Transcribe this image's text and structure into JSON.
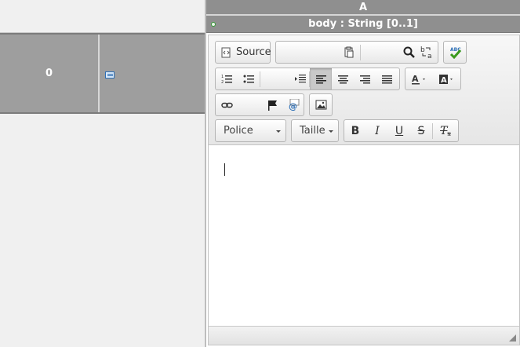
{
  "grid": {
    "row_value": "0"
  },
  "column_header": "A",
  "field_header": "body : String [0..1]",
  "toolbar": {
    "source_label": "Source",
    "font_label": "Police",
    "size_label": "Taille",
    "bold_label": "B",
    "italic_label": "I",
    "underline_label": "U",
    "strike_label": "S",
    "remove_format_label": "T"
  },
  "icons": {
    "note": "note-icon",
    "expand": "expand-icon",
    "source": "source-icon",
    "paste": "paste-icon",
    "find": "find-icon",
    "replace": "replace-icon",
    "spellcheck": "spellcheck-icon",
    "numbered_list": "numbered-list-icon",
    "bullet_list": "bullet-list-icon",
    "indent": "indent-icon",
    "align_left": "align-left-icon",
    "align_center": "align-center-icon",
    "align_right": "align-right-icon",
    "justify": "justify-icon",
    "text_color": "text-color-icon",
    "bg_color": "background-color-icon",
    "link": "link-icon",
    "anchor": "anchor-flag-icon",
    "email": "email-icon",
    "image": "image-icon",
    "resize": "resize-icon"
  },
  "colors": {
    "header_gray": "#8f8f8f",
    "row_gray": "#9e9e9e",
    "spellcheck_green": "#3a9a1e",
    "spellcheck_blue": "#2d6fb6"
  }
}
